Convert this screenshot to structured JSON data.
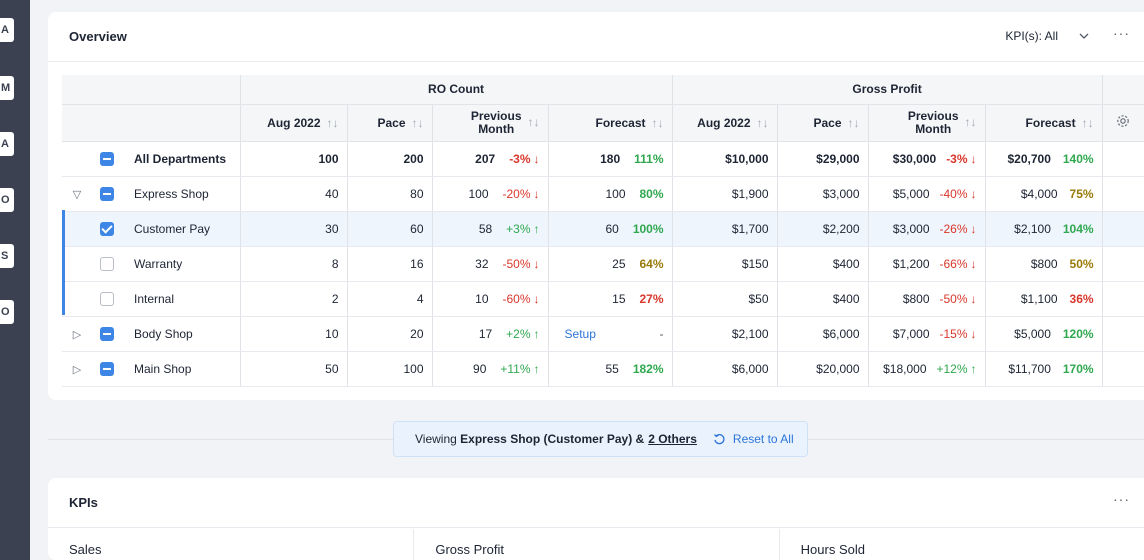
{
  "rail": {
    "tabs": [
      "A",
      "M",
      "A",
      "O",
      "S",
      "O"
    ]
  },
  "overview": {
    "title": "Overview",
    "kpi_filter": "KPI(s): All",
    "more": "···",
    "groups": {
      "ro_count": "RO Count",
      "gross_profit": "Gross Profit"
    },
    "columns": {
      "aug": "Aug 2022",
      "pace": "Pace",
      "prev1": "Previous",
      "prev2": "Month",
      "forecast": "Forecast"
    },
    "sort_glyph": "↑↓",
    "rows": [
      {
        "name": "All Departments",
        "ro": [
          "100",
          "200",
          "207",
          "-3%",
          "180",
          "111%"
        ],
        "gp": [
          "$10,000",
          "$29,000",
          "$30,000",
          "-3%",
          "$20,700",
          "140%"
        ]
      },
      {
        "name": "Express Shop",
        "ro": [
          "40",
          "80",
          "100",
          "-20%",
          "100",
          "80%"
        ],
        "gp": [
          "$1,900",
          "$3,000",
          "$5,000",
          "-40%",
          "$4,000",
          "75%"
        ]
      },
      {
        "name": "Customer Pay",
        "ro": [
          "30",
          "60",
          "58",
          "+3%",
          "60",
          "100%"
        ],
        "gp": [
          "$1,700",
          "$2,200",
          "$3,000",
          "-26%",
          "$2,100",
          "104%"
        ]
      },
      {
        "name": "Warranty",
        "ro": [
          "8",
          "16",
          "32",
          "-50%",
          "25",
          "64%"
        ],
        "gp": [
          "$150",
          "$400",
          "$1,200",
          "-66%",
          "$800",
          "50%"
        ]
      },
      {
        "name": "Internal",
        "ro": [
          "2",
          "4",
          "10",
          "-60%",
          "15",
          "27%"
        ],
        "gp": [
          "$50",
          "$400",
          "$800",
          "-50%",
          "$1,100",
          "36%"
        ]
      },
      {
        "name": "Body Shop",
        "ro": [
          "10",
          "20",
          "17",
          "+2%",
          "Setup",
          "-"
        ],
        "gp": [
          "$2,100",
          "$6,000",
          "$7,000",
          "-15%",
          "$5,000",
          "120%"
        ]
      },
      {
        "name": "Main Shop",
        "ro": [
          "50",
          "100",
          "90",
          "+11%",
          "55",
          "182%"
        ],
        "gp": [
          "$6,000",
          "$20,000",
          "$18,000",
          "+12%",
          "$11,700",
          "170%"
        ]
      }
    ],
    "arrows": {
      "up": "↑",
      "down": "↓"
    }
  },
  "filter": {
    "prefix": "Viewing",
    "selection": "Express Shop (Customer Pay) &",
    "others": "2 Others",
    "reset": "Reset to All"
  },
  "kpis": {
    "title": "KPIs",
    "more": "···",
    "columns": [
      "Sales",
      "Gross Profit",
      "Hours Sold"
    ]
  },
  "colors": {
    "accent": "#3d86e6",
    "negative": "#d9372b",
    "positive": "#2fa84f",
    "warning": "#9a7a0a"
  }
}
